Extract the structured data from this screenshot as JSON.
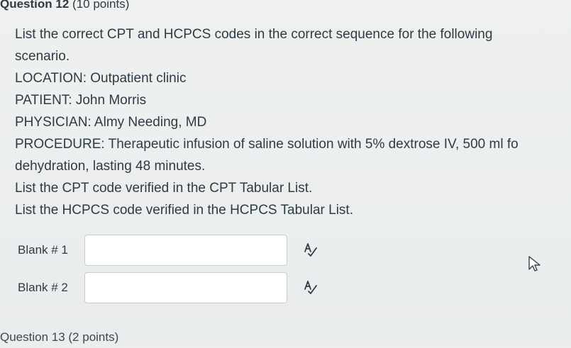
{
  "question": {
    "title": "Question 12",
    "points": "(10 points)",
    "lines": [
      "List the correct CPT and HCPCS codes in the correct sequence for the following",
      "scenario.",
      "LOCATION: Outpatient clinic",
      "PATIENT: John Morris",
      "PHYSICIAN: Almy Needing, MD",
      "PROCEDURE: Therapeutic infusion of saline solution with 5% dextrose IV, 500 ml fo",
      "dehydration, lasting 48 minutes.",
      "List the CPT code verified in the CPT Tabular List.",
      "List the HCPCS code verified in the HCPCS Tabular List."
    ]
  },
  "blanks": [
    {
      "label": "Blank # 1",
      "value": ""
    },
    {
      "label": "Blank # 2",
      "value": ""
    }
  ],
  "icons": {
    "spellcheck": "spellcheck-icon",
    "cursor": "mouse-cursor-icon"
  },
  "next_question": {
    "label": "Question 13 (2 points)"
  }
}
